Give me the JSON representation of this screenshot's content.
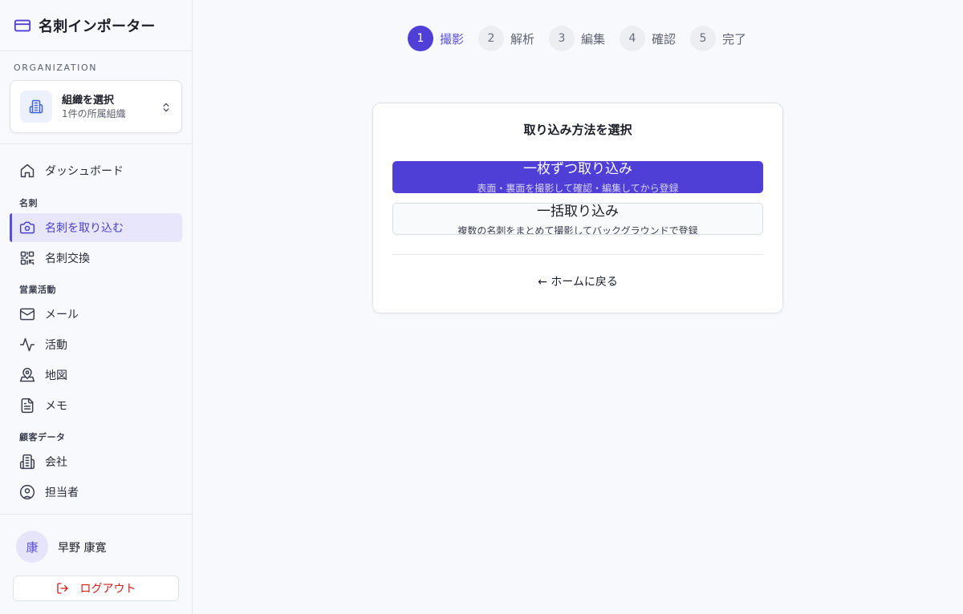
{
  "app": {
    "title": "名刺インポーター"
  },
  "org": {
    "section_label": "ORGANIZATION",
    "title": "組織を選択",
    "subtitle": "1件の所属組織"
  },
  "nav": {
    "dashboard": "ダッシュボード",
    "section_meishi": "名刺",
    "import": "名刺を取り込む",
    "exchange": "名刺交換",
    "section_sales": "営業活動",
    "mail": "メール",
    "activity": "活動",
    "map": "地図",
    "memo": "メモ",
    "section_customer": "顧客データ",
    "company": "会社",
    "contact": "担当者"
  },
  "user": {
    "avatar": "康",
    "name": "早野 康寛",
    "logout": "ログアウト"
  },
  "steps": [
    {
      "num": "1",
      "label": "撮影"
    },
    {
      "num": "2",
      "label": "解析"
    },
    {
      "num": "3",
      "label": "編集"
    },
    {
      "num": "4",
      "label": "確認"
    },
    {
      "num": "5",
      "label": "完了"
    }
  ],
  "card": {
    "title": "取り込み方法を選択",
    "single_title": "一枚ずつ取り込み",
    "single_sub": "表面・裏面を撮影して確認・編集してから登録",
    "bulk_title": "一括取り込み",
    "bulk_sub": "複数の名刺をまとめて撮影してバックグラウンドで登録",
    "back": "← ホームに戻る"
  },
  "colors": {
    "accent": "#4f3fd6",
    "danger": "#d21b1b"
  }
}
